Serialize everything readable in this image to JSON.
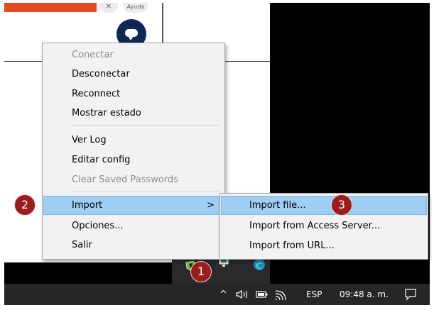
{
  "background_app": {
    "mini_buttons": [
      "✕",
      "Ayuda"
    ]
  },
  "context_menu": {
    "groups": [
      [
        {
          "label": "Conectar",
          "enabled": false
        },
        {
          "label": "Desconectar",
          "enabled": true
        },
        {
          "label": "Reconnect",
          "enabled": true
        },
        {
          "label": "Mostrar estado",
          "enabled": true
        }
      ],
      [
        {
          "label": "Ver Log",
          "enabled": true
        },
        {
          "label": "Editar config",
          "enabled": true
        },
        {
          "label": "Clear Saved Passwords",
          "enabled": false
        }
      ],
      [
        {
          "label": "Import",
          "enabled": true,
          "highlighted": true,
          "has_submenu": true,
          "arrow": ">"
        },
        {
          "label": "Opciones...",
          "enabled": true
        },
        {
          "label": "Salir",
          "enabled": true
        }
      ]
    ]
  },
  "submenu": {
    "items": [
      {
        "label": "Import file...",
        "highlighted": true
      },
      {
        "label": "Import from Access Server...",
        "highlighted": false
      },
      {
        "label": "Import from URL...",
        "highlighted": false
      }
    ]
  },
  "step_badges": [
    "1",
    "2",
    "3"
  ],
  "tray": {
    "chevron": "^",
    "volume_icon": "speaker-icon",
    "battery_icon": "battery-icon",
    "wifi_icon": "wifi-icon",
    "language": "ESP",
    "clock": "09:48 a. m.",
    "notification_icon": "action-center-icon"
  },
  "colors": {
    "menu_highlight": "#9fcdf3",
    "badge": "#9c1c1c",
    "taskbar": "#262626",
    "disabled_text": "#8c8c8c"
  }
}
